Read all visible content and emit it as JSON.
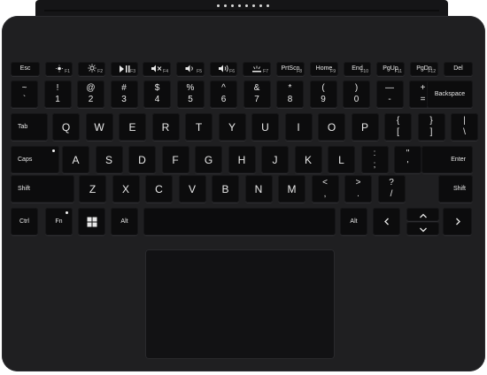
{
  "keyboard": {
    "accent": "#1f1f21",
    "key_color": "#0c0c0d",
    "legend_color": "#e8e8e8",
    "function_row": [
      {
        "name": "esc",
        "label": "Esc"
      },
      {
        "name": "f1",
        "icon": "brightness-down-icon",
        "fn": "F1"
      },
      {
        "name": "f2",
        "icon": "brightness-up-icon",
        "fn": "F2"
      },
      {
        "name": "f3",
        "icon": "play-pause-icon",
        "fn": "F3"
      },
      {
        "name": "f4",
        "icon": "mute-icon",
        "fn": "F4"
      },
      {
        "name": "f5",
        "icon": "volume-down-icon",
        "fn": "F5"
      },
      {
        "name": "f6",
        "icon": "volume-up-icon",
        "fn": "F6"
      },
      {
        "name": "f7",
        "icon": "backlight-icon",
        "fn": "F7"
      },
      {
        "name": "prtscn",
        "label": "PrtScn",
        "fn": "F8"
      },
      {
        "name": "home",
        "label": "Home",
        "fn": "F9"
      },
      {
        "name": "end",
        "label": "End",
        "fn": "F10"
      },
      {
        "name": "pgup",
        "label": "PgUp",
        "fn": "F11"
      },
      {
        "name": "pgdn",
        "label": "PgDn",
        "fn": "F12"
      },
      {
        "name": "del",
        "label": "Del"
      }
    ],
    "number_row": [
      {
        "name": "tilde",
        "top": "~",
        "bottom": "`"
      },
      {
        "name": "1",
        "top": "!",
        "bottom": "1"
      },
      {
        "name": "2",
        "top": "@",
        "bottom": "2"
      },
      {
        "name": "3",
        "top": "#",
        "bottom": "3"
      },
      {
        "name": "4",
        "top": "$",
        "bottom": "4"
      },
      {
        "name": "5",
        "top": "%",
        "bottom": "5"
      },
      {
        "name": "6",
        "top": "^",
        "bottom": "6"
      },
      {
        "name": "7",
        "top": "&",
        "bottom": "7"
      },
      {
        "name": "8",
        "top": "*",
        "bottom": "8"
      },
      {
        "name": "9",
        "top": "(",
        "bottom": "9"
      },
      {
        "name": "0",
        "top": ")",
        "bottom": "0"
      },
      {
        "name": "minus",
        "top": "—",
        "bottom": "-"
      },
      {
        "name": "equals",
        "top": "+",
        "bottom": "="
      },
      {
        "name": "backspace",
        "label": "Backspace"
      }
    ],
    "qwerty_row": [
      {
        "name": "tab",
        "label": "Tab"
      },
      {
        "name": "q",
        "label": "Q"
      },
      {
        "name": "w",
        "label": "W"
      },
      {
        "name": "e",
        "label": "E"
      },
      {
        "name": "r",
        "label": "R"
      },
      {
        "name": "t",
        "label": "T"
      },
      {
        "name": "y",
        "label": "Y"
      },
      {
        "name": "u",
        "label": "U"
      },
      {
        "name": "i",
        "label": "I"
      },
      {
        "name": "o",
        "label": "O"
      },
      {
        "name": "p",
        "label": "P"
      },
      {
        "name": "lbracket",
        "top": "{",
        "bottom": "["
      },
      {
        "name": "rbracket",
        "top": "}",
        "bottom": "]"
      },
      {
        "name": "backslash",
        "top": "|",
        "bottom": "\\"
      }
    ],
    "home_row": [
      {
        "name": "caps",
        "label": "Caps"
      },
      {
        "name": "a",
        "label": "A"
      },
      {
        "name": "s",
        "label": "S"
      },
      {
        "name": "d",
        "label": "D"
      },
      {
        "name": "f",
        "label": "F"
      },
      {
        "name": "g",
        "label": "G"
      },
      {
        "name": "h",
        "label": "H"
      },
      {
        "name": "j",
        "label": "J"
      },
      {
        "name": "k",
        "label": "K"
      },
      {
        "name": "l",
        "label": "L"
      },
      {
        "name": "semicolon",
        "top": ":",
        "bottom": ";"
      },
      {
        "name": "quote",
        "top": "\"",
        "bottom": "'"
      },
      {
        "name": "enter",
        "label": "Enter"
      }
    ],
    "shift_row": [
      {
        "name": "lshift",
        "label": "Shift"
      },
      {
        "name": "z",
        "label": "Z"
      },
      {
        "name": "x",
        "label": "X"
      },
      {
        "name": "c",
        "label": "C"
      },
      {
        "name": "v",
        "label": "V"
      },
      {
        "name": "b",
        "label": "B"
      },
      {
        "name": "n",
        "label": "N"
      },
      {
        "name": "m",
        "label": "M"
      },
      {
        "name": "comma",
        "top": "<",
        "bottom": ","
      },
      {
        "name": "period",
        "top": ">",
        "bottom": "."
      },
      {
        "name": "slash",
        "top": "?",
        "bottom": "/"
      },
      {
        "name": "rshift",
        "label": "Shift"
      }
    ],
    "bottom_row": [
      {
        "name": "ctrl",
        "label": "Ctrl"
      },
      {
        "name": "fn",
        "label": "Fn"
      },
      {
        "name": "windows",
        "icon": "windows-logo-icon"
      },
      {
        "name": "lalt",
        "label": "Alt"
      },
      {
        "name": "space",
        "label": ""
      },
      {
        "name": "ralt",
        "label": "Alt"
      },
      {
        "name": "left",
        "icon": "arrow-left-icon"
      },
      {
        "name": "up",
        "icon": "arrow-up-icon"
      },
      {
        "name": "down",
        "icon": "arrow-down-icon"
      },
      {
        "name": "right",
        "icon": "arrow-right-icon"
      }
    ]
  }
}
